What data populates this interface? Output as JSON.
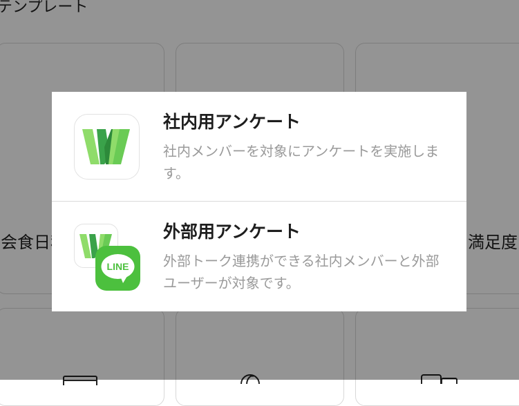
{
  "background": {
    "section_title": "テンプレート",
    "cards": [
      {
        "label": "会食日程"
      },
      {
        "label": ""
      },
      {
        "label": "満足度"
      }
    ],
    "icons": [
      "calendar-icon",
      "globe-icon",
      "device-icon"
    ]
  },
  "modal": {
    "options": [
      {
        "title": "社内用アンケート",
        "description": "社内メンバーを対象にアンケートを実施します。",
        "icon": "works-icon"
      },
      {
        "title": "外部用アンケート",
        "description": "外部トーク連携ができる社内メンバーと外部ユーザーが対象です。",
        "icon": "works-line-icon",
        "badge_text": "LINE"
      }
    ]
  },
  "colors": {
    "overlay": "#000000",
    "line_green": "#4cc03e",
    "works_green_dark": "#3aa24a",
    "works_green_light": "#8fdc6a"
  }
}
